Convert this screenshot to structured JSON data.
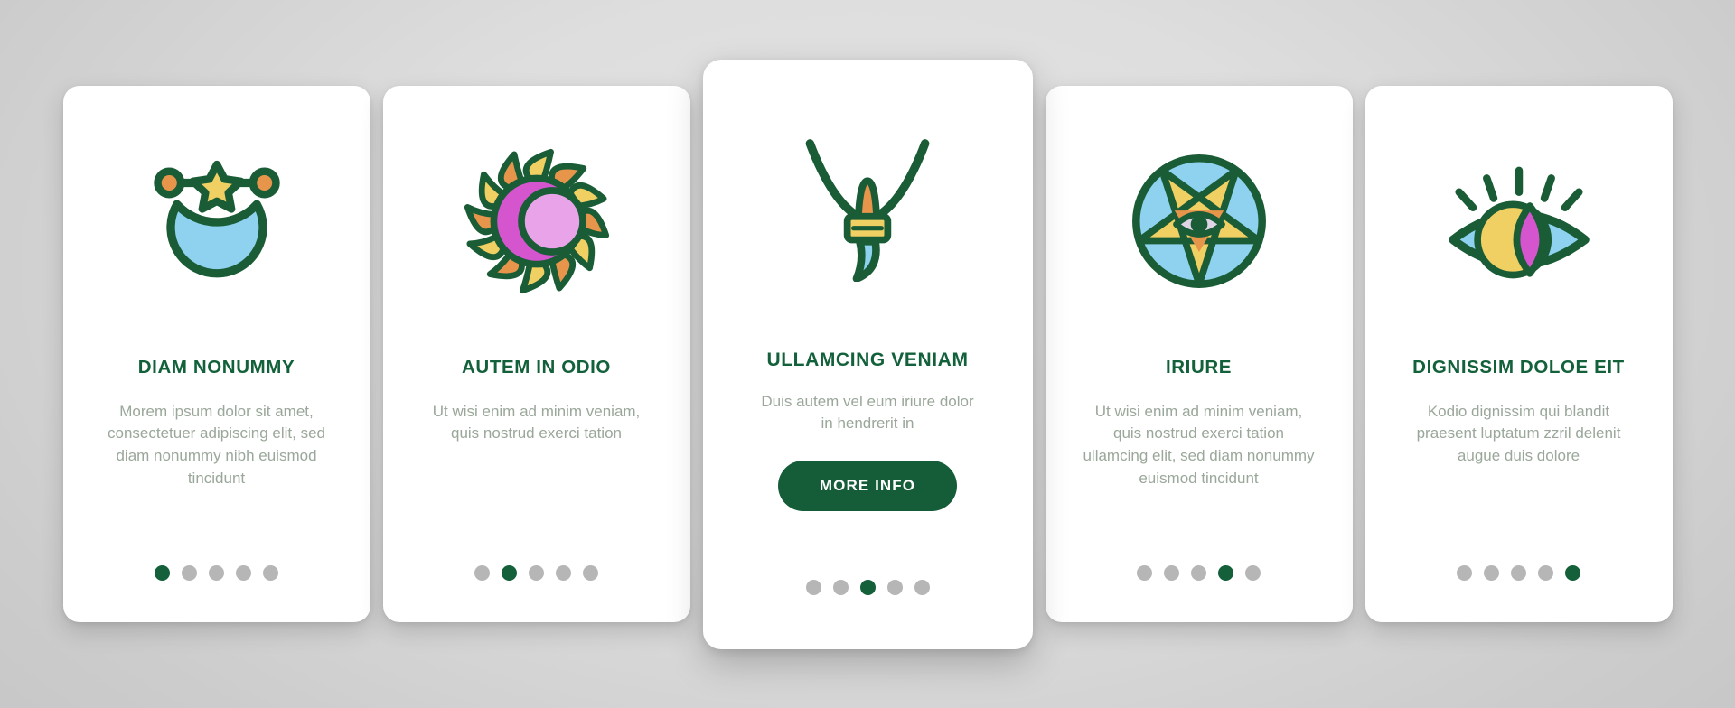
{
  "theme": {
    "background": "#d6d6d6",
    "card_bg": "#ffffff",
    "accent_green": "#13603a",
    "title_green": "#12613a",
    "body_text": "#9aa79a",
    "dot_inactive": "#b6b6b6",
    "icon_stroke": "#1a5c36",
    "icon_blue": "#8ed2f0",
    "icon_yellow": "#f0cf63",
    "icon_orange": "#e8954c",
    "icon_magenta": "#d555cf",
    "icon_pink": "#e9a4e9"
  },
  "cards": [
    {
      "icon": "crescent-moon-star-icon",
      "title": "DIAM NONUMMY",
      "body": "Morem ipsum dolor sit amet, consectetuer adipiscing elit, sed diam nonummy nibh euismod tincidunt",
      "dots": 5,
      "active_dot": 1,
      "featured": false,
      "cta": null
    },
    {
      "icon": "solar-eclipse-sun-icon",
      "title": "AUTEM IN ODIO",
      "body": "Ut wisi enim ad minim veniam, quis nostrud exerci tation",
      "dots": 5,
      "active_dot": 2,
      "featured": false,
      "cta": null
    },
    {
      "icon": "amulet-necklace-icon",
      "title": "ULLAMCING VENIAM",
      "body": "Duis autem vel eum iriure dolor in hendrerit in",
      "dots": 5,
      "active_dot": 3,
      "featured": true,
      "cta": "MORE INFO"
    },
    {
      "icon": "pentagram-eye-icon",
      "title": "IRIURE",
      "body": "Ut wisi enim ad minim veniam, quis nostrud exerci tation ullamcing elit, sed diam nonummy euismod tincidunt",
      "dots": 5,
      "active_dot": 4,
      "featured": false,
      "cta": null
    },
    {
      "icon": "mystic-eye-icon",
      "title": "DIGNISSIM DOLOE EIT",
      "body": "Kodio dignissim qui blandit praesent luptatum zzril delenit augue duis dolore",
      "dots": 5,
      "active_dot": 5,
      "featured": false,
      "cta": null
    }
  ]
}
